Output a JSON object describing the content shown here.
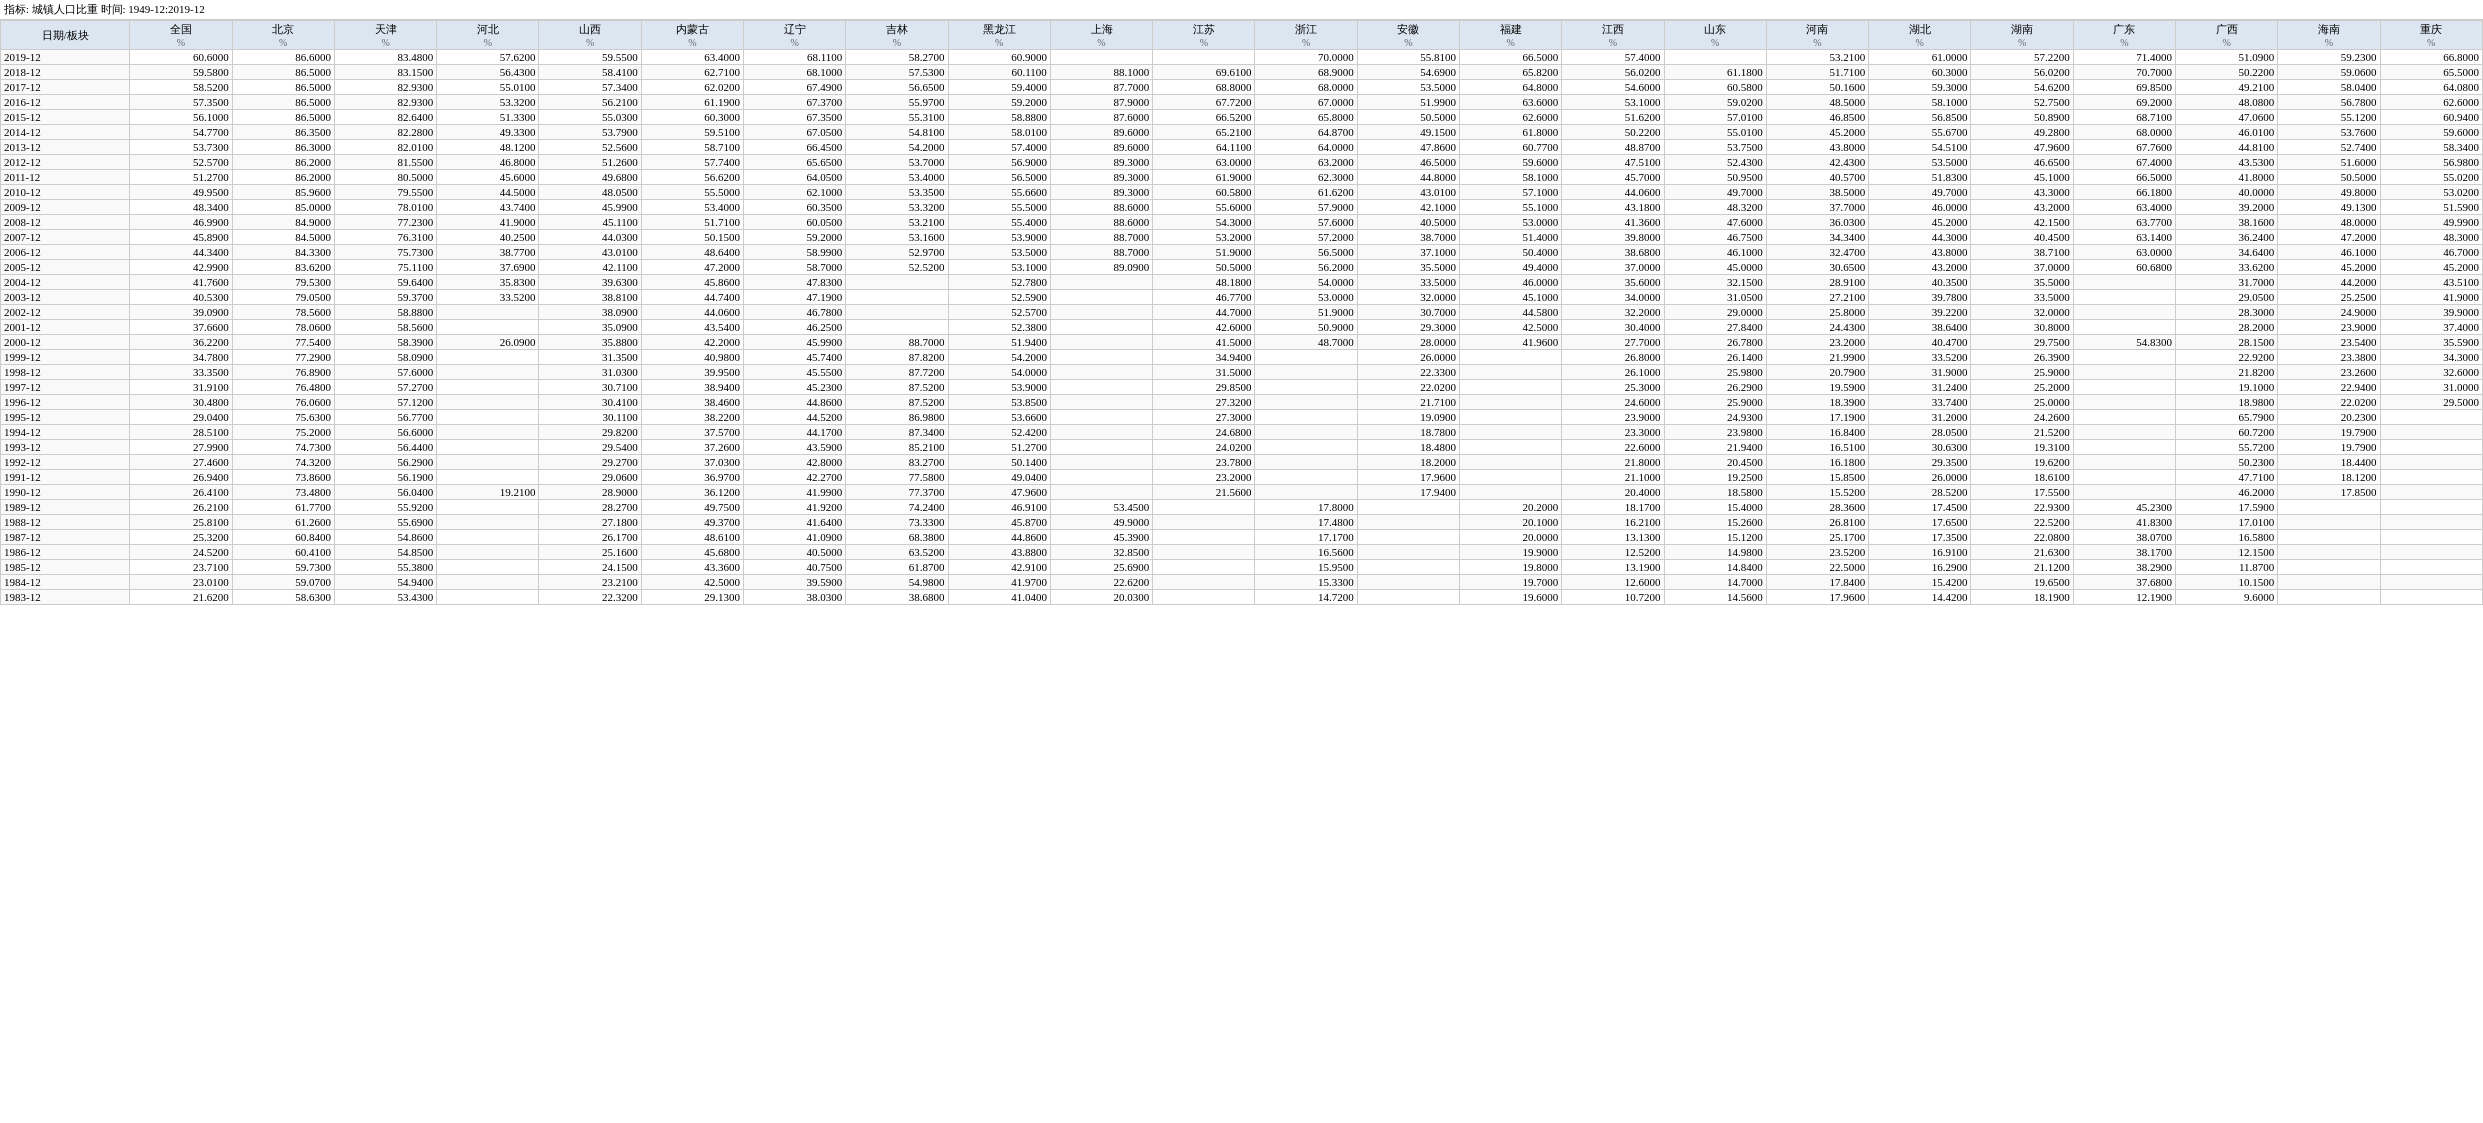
{
  "title": "指标: 城镇人口比重  时间: 1949-12:2019-12",
  "columns": [
    "日期/板块",
    "全国\n%",
    "北京\n%",
    "天津\n%",
    "河北\n%",
    "山西\n%",
    "内蒙古\n%",
    "辽宁\n%",
    "吉林\n%",
    "黑龙江\n%",
    "上海\n%",
    "江苏\n%",
    "浙江\n%",
    "安徽\n%",
    "福建\n%",
    "江西\n%",
    "山东\n%",
    "河南\n%",
    "湖北\n%",
    "湖南\n%",
    "广东\n%",
    "广西\n%",
    "海南\n%",
    "重庆\n%"
  ],
  "rows": [
    [
      "2019-12",
      "60.6000",
      "86.6000",
      "83.4800",
      "57.6200",
      "59.5500",
      "63.4000",
      "68.1100",
      "58.2700",
      "60.9000",
      "",
      "",
      "70.0000",
      "55.8100",
      "66.5000",
      "57.4000",
      "",
      "53.2100",
      "61.0000",
      "57.2200",
      "71.4000",
      "51.0900",
      "59.2300",
      "66.8000"
    ],
    [
      "2018-12",
      "59.5800",
      "86.5000",
      "83.1500",
      "56.4300",
      "58.4100",
      "62.7100",
      "68.1000",
      "57.5300",
      "60.1100",
      "88.1000",
      "69.6100",
      "68.9000",
      "54.6900",
      "65.8200",
      "56.0200",
      "61.1800",
      "51.7100",
      "60.3000",
      "56.0200",
      "70.7000",
      "50.2200",
      "59.0600",
      "65.5000"
    ],
    [
      "2017-12",
      "58.5200",
      "86.5000",
      "82.9300",
      "55.0100",
      "57.3400",
      "62.0200",
      "67.4900",
      "56.6500",
      "59.4000",
      "87.7000",
      "68.8000",
      "68.0000",
      "53.5000",
      "64.8000",
      "54.6000",
      "60.5800",
      "50.1600",
      "59.3000",
      "54.6200",
      "69.8500",
      "49.2100",
      "58.0400",
      "64.0800"
    ],
    [
      "2016-12",
      "57.3500",
      "86.5000",
      "82.9300",
      "53.3200",
      "56.2100",
      "61.1900",
      "67.3700",
      "55.9700",
      "59.2000",
      "87.9000",
      "67.7200",
      "67.0000",
      "51.9900",
      "63.6000",
      "53.1000",
      "59.0200",
      "48.5000",
      "58.1000",
      "52.7500",
      "69.2000",
      "48.0800",
      "56.7800",
      "62.6000"
    ],
    [
      "2015-12",
      "56.1000",
      "86.5000",
      "82.6400",
      "51.3300",
      "55.0300",
      "60.3000",
      "67.3500",
      "55.3100",
      "58.8800",
      "87.6000",
      "66.5200",
      "65.8000",
      "50.5000",
      "62.6000",
      "51.6200",
      "57.0100",
      "46.8500",
      "56.8500",
      "50.8900",
      "68.7100",
      "47.0600",
      "55.1200",
      "60.9400"
    ],
    [
      "2014-12",
      "54.7700",
      "86.3500",
      "82.2800",
      "49.3300",
      "53.7900",
      "59.5100",
      "67.0500",
      "54.8100",
      "58.0100",
      "89.6000",
      "65.2100",
      "64.8700",
      "49.1500",
      "61.8000",
      "50.2200",
      "55.0100",
      "45.2000",
      "55.6700",
      "49.2800",
      "68.0000",
      "46.0100",
      "53.7600",
      "59.6000"
    ],
    [
      "2013-12",
      "53.7300",
      "86.3000",
      "82.0100",
      "48.1200",
      "52.5600",
      "58.7100",
      "66.4500",
      "54.2000",
      "57.4000",
      "89.6000",
      "64.1100",
      "64.0000",
      "47.8600",
      "60.7700",
      "48.8700",
      "53.7500",
      "43.8000",
      "54.5100",
      "47.9600",
      "67.7600",
      "44.8100",
      "52.7400",
      "58.3400"
    ],
    [
      "2012-12",
      "52.5700",
      "86.2000",
      "81.5500",
      "46.8000",
      "51.2600",
      "57.7400",
      "65.6500",
      "53.7000",
      "56.9000",
      "89.3000",
      "63.0000",
      "63.2000",
      "46.5000",
      "59.6000",
      "47.5100",
      "52.4300",
      "42.4300",
      "53.5000",
      "46.6500",
      "67.4000",
      "43.5300",
      "51.6000",
      "56.9800"
    ],
    [
      "2011-12",
      "51.2700",
      "86.2000",
      "80.5000",
      "45.6000",
      "49.6800",
      "56.6200",
      "64.0500",
      "53.4000",
      "56.5000",
      "89.3000",
      "61.9000",
      "62.3000",
      "44.8000",
      "58.1000",
      "45.7000",
      "50.9500",
      "40.5700",
      "51.8300",
      "45.1000",
      "66.5000",
      "41.8000",
      "50.5000",
      "55.0200"
    ],
    [
      "2010-12",
      "49.9500",
      "85.9600",
      "79.5500",
      "44.5000",
      "48.0500",
      "55.5000",
      "62.1000",
      "53.3500",
      "55.6600",
      "89.3000",
      "60.5800",
      "61.6200",
      "43.0100",
      "57.1000",
      "44.0600",
      "49.7000",
      "38.5000",
      "49.7000",
      "43.3000",
      "66.1800",
      "40.0000",
      "49.8000",
      "53.0200"
    ],
    [
      "2009-12",
      "48.3400",
      "85.0000",
      "78.0100",
      "43.7400",
      "45.9900",
      "53.4000",
      "60.3500",
      "53.3200",
      "55.5000",
      "88.6000",
      "55.6000",
      "57.9000",
      "42.1000",
      "55.1000",
      "43.1800",
      "48.3200",
      "37.7000",
      "46.0000",
      "43.2000",
      "63.4000",
      "39.2000",
      "49.1300",
      "51.5900"
    ],
    [
      "2008-12",
      "46.9900",
      "84.9000",
      "77.2300",
      "41.9000",
      "45.1100",
      "51.7100",
      "60.0500",
      "53.2100",
      "55.4000",
      "88.6000",
      "54.3000",
      "57.6000",
      "40.5000",
      "53.0000",
      "41.3600",
      "47.6000",
      "36.0300",
      "45.2000",
      "42.1500",
      "63.7700",
      "38.1600",
      "48.0000",
      "49.9900"
    ],
    [
      "2007-12",
      "45.8900",
      "84.5000",
      "76.3100",
      "40.2500",
      "44.0300",
      "50.1500",
      "59.2000",
      "53.1600",
      "53.9000",
      "88.7000",
      "53.2000",
      "57.2000",
      "38.7000",
      "51.4000",
      "39.8000",
      "46.7500",
      "34.3400",
      "44.3000",
      "40.4500",
      "63.1400",
      "36.2400",
      "47.2000",
      "48.3000"
    ],
    [
      "2006-12",
      "44.3400",
      "84.3300",
      "75.7300",
      "38.7700",
      "43.0100",
      "48.6400",
      "58.9900",
      "52.9700",
      "53.5000",
      "88.7000",
      "51.9000",
      "56.5000",
      "37.1000",
      "50.4000",
      "38.6800",
      "46.1000",
      "32.4700",
      "43.8000",
      "38.7100",
      "63.0000",
      "34.6400",
      "46.1000",
      "46.7000"
    ],
    [
      "2005-12",
      "42.9900",
      "83.6200",
      "75.1100",
      "37.6900",
      "42.1100",
      "47.2000",
      "58.7000",
      "52.5200",
      "53.1000",
      "89.0900",
      "50.5000",
      "56.2000",
      "35.5000",
      "49.4000",
      "37.0000",
      "45.0000",
      "30.6500",
      "43.2000",
      "37.0000",
      "60.6800",
      "33.6200",
      "45.2000",
      "45.2000"
    ],
    [
      "2004-12",
      "41.7600",
      "79.5300",
      "59.6400",
      "35.8300",
      "39.6300",
      "45.8600",
      "47.8300",
      "",
      "52.7800",
      "",
      "48.1800",
      "54.0000",
      "33.5000",
      "46.0000",
      "35.6000",
      "32.1500",
      "28.9100",
      "40.3500",
      "35.5000",
      "",
      "31.7000",
      "44.2000",
      "43.5100"
    ],
    [
      "2003-12",
      "40.5300",
      "79.0500",
      "59.3700",
      "33.5200",
      "38.8100",
      "44.7400",
      "47.1900",
      "",
      "52.5900",
      "",
      "46.7700",
      "53.0000",
      "32.0000",
      "45.1000",
      "34.0000",
      "31.0500",
      "27.2100",
      "39.7800",
      "33.5000",
      "",
      "29.0500",
      "25.2500",
      "41.9000"
    ],
    [
      "2002-12",
      "39.0900",
      "78.5600",
      "58.8800",
      "",
      "38.0900",
      "44.0600",
      "46.7800",
      "",
      "52.5700",
      "",
      "44.7000",
      "51.9000",
      "30.7000",
      "44.5800",
      "32.2000",
      "29.0000",
      "25.8000",
      "39.2200",
      "32.0000",
      "",
      "28.3000",
      "24.9000",
      "39.9000"
    ],
    [
      "2001-12",
      "37.6600",
      "78.0600",
      "58.5600",
      "",
      "35.0900",
      "43.5400",
      "46.2500",
      "",
      "52.3800",
      "",
      "42.6000",
      "50.9000",
      "29.3000",
      "42.5000",
      "30.4000",
      "27.8400",
      "24.4300",
      "38.6400",
      "30.8000",
      "",
      "28.2000",
      "23.9000",
      "37.4000"
    ],
    [
      "2000-12",
      "36.2200",
      "77.5400",
      "58.3900",
      "26.0900",
      "35.8800",
      "42.2000",
      "45.9900",
      "88.7000",
      "51.9400",
      "",
      "41.5000",
      "48.7000",
      "28.0000",
      "41.9600",
      "27.7000",
      "26.7800",
      "23.2000",
      "40.4700",
      "29.7500",
      "54.8300",
      "28.1500",
      "23.5400",
      "35.5900"
    ],
    [
      "1999-12",
      "34.7800",
      "77.2900",
      "58.0900",
      "",
      "31.3500",
      "40.9800",
      "45.7400",
      "87.8200",
      "54.2000",
      "",
      "34.9400",
      "",
      "26.0000",
      "",
      "26.8000",
      "26.1400",
      "21.9900",
      "33.5200",
      "26.3900",
      "",
      "22.9200",
      "23.3800",
      "34.3000"
    ],
    [
      "1998-12",
      "33.3500",
      "76.8900",
      "57.6000",
      "",
      "31.0300",
      "39.9500",
      "45.5500",
      "87.7200",
      "54.0000",
      "",
      "31.5000",
      "",
      "22.3300",
      "",
      "26.1000",
      "25.9800",
      "20.7900",
      "31.9000",
      "25.9000",
      "",
      "21.8200",
      "23.2600",
      "32.6000"
    ],
    [
      "1997-12",
      "31.9100",
      "76.4800",
      "57.2700",
      "",
      "30.7100",
      "38.9400",
      "45.2300",
      "87.5200",
      "53.9000",
      "",
      "29.8500",
      "",
      "22.0200",
      "",
      "25.3000",
      "26.2900",
      "19.5900",
      "31.2400",
      "25.2000",
      "",
      "19.1000",
      "22.9400",
      "31.0000"
    ],
    [
      "1996-12",
      "30.4800",
      "76.0600",
      "57.1200",
      "",
      "30.4100",
      "38.4600",
      "44.8600",
      "87.5200",
      "53.8500",
      "",
      "27.3200",
      "",
      "21.7100",
      "",
      "24.6000",
      "25.9000",
      "18.3900",
      "33.7400",
      "25.0000",
      "",
      "18.9800",
      "22.0200",
      "29.5000"
    ],
    [
      "1995-12",
      "29.0400",
      "75.6300",
      "56.7700",
      "",
      "30.1100",
      "38.2200",
      "44.5200",
      "86.9800",
      "53.6600",
      "",
      "27.3000",
      "",
      "19.0900",
      "",
      "23.9000",
      "24.9300",
      "17.1900",
      "31.2000",
      "24.2600",
      "",
      "65.7900",
      "20.2300",
      ""
    ],
    [
      "1994-12",
      "28.5100",
      "75.2000",
      "56.6000",
      "",
      "29.8200",
      "37.5700",
      "44.1700",
      "87.3400",
      "52.4200",
      "",
      "24.6800",
      "",
      "18.7800",
      "",
      "23.3000",
      "23.9800",
      "16.8400",
      "28.0500",
      "21.5200",
      "",
      "60.7200",
      "19.7900",
      ""
    ],
    [
      "1993-12",
      "27.9900",
      "74.7300",
      "56.4400",
      "",
      "29.5400",
      "37.2600",
      "43.5900",
      "85.2100",
      "51.2700",
      "",
      "24.0200",
      "",
      "18.4800",
      "",
      "22.6000",
      "21.9400",
      "16.5100",
      "30.6300",
      "19.3100",
      "",
      "55.7200",
      "19.7900",
      ""
    ],
    [
      "1992-12",
      "27.4600",
      "74.3200",
      "56.2900",
      "",
      "29.2700",
      "37.0300",
      "42.8000",
      "83.2700",
      "50.1400",
      "",
      "23.7800",
      "",
      "18.2000",
      "",
      "21.8000",
      "20.4500",
      "16.1800",
      "29.3500",
      "19.6200",
      "",
      "50.2300",
      "18.4400",
      ""
    ],
    [
      "1991-12",
      "26.9400",
      "73.8600",
      "56.1900",
      "",
      "29.0600",
      "36.9700",
      "42.2700",
      "77.5800",
      "49.0400",
      "",
      "23.2000",
      "",
      "17.9600",
      "",
      "21.1000",
      "19.2500",
      "15.8500",
      "26.0000",
      "18.6100",
      "",
      "47.7100",
      "18.1200",
      ""
    ],
    [
      "1990-12",
      "26.4100",
      "73.4800",
      "56.0400",
      "19.2100",
      "28.9000",
      "36.1200",
      "41.9900",
      "77.3700",
      "47.9600",
      "",
      "21.5600",
      "",
      "17.9400",
      "",
      "20.4000",
      "18.5800",
      "15.5200",
      "28.5200",
      "17.5500",
      "",
      "46.2000",
      "17.8500",
      ""
    ],
    [
      "1989-12",
      "26.2100",
      "61.7700",
      "55.9200",
      "",
      "28.2700",
      "49.7500",
      "41.9200",
      "74.2400",
      "46.9100",
      "53.4500",
      "",
      "17.8000",
      "",
      "20.2000",
      "18.1700",
      "15.4000",
      "28.3600",
      "17.4500",
      "22.9300",
      "45.2300",
      "17.5900",
      "",
      ""
    ],
    [
      "1988-12",
      "25.8100",
      "61.2600",
      "55.6900",
      "",
      "27.1800",
      "49.3700",
      "41.6400",
      "73.3300",
      "45.8700",
      "49.9000",
      "",
      "17.4800",
      "",
      "20.1000",
      "16.2100",
      "15.2600",
      "26.8100",
      "17.6500",
      "22.5200",
      "41.8300",
      "17.0100",
      "",
      ""
    ],
    [
      "1987-12",
      "25.3200",
      "60.8400",
      "54.8600",
      "",
      "26.1700",
      "48.6100",
      "41.0900",
      "68.3800",
      "44.8600",
      "45.3900",
      "",
      "17.1700",
      "",
      "20.0000",
      "13.1300",
      "15.1200",
      "25.1700",
      "17.3500",
      "22.0800",
      "38.0700",
      "16.5800",
      "",
      ""
    ],
    [
      "1986-12",
      "24.5200",
      "60.4100",
      "54.8500",
      "",
      "25.1600",
      "45.6800",
      "40.5000",
      "63.5200",
      "43.8800",
      "32.8500",
      "",
      "16.5600",
      "",
      "19.9000",
      "12.5200",
      "14.9800",
      "23.5200",
      "16.9100",
      "21.6300",
      "38.1700",
      "12.1500",
      "",
      ""
    ],
    [
      "1985-12",
      "23.7100",
      "59.7300",
      "55.3800",
      "",
      "24.1500",
      "43.3600",
      "40.7500",
      "61.8700",
      "42.9100",
      "25.6900",
      "",
      "15.9500",
      "",
      "19.8000",
      "13.1900",
      "14.8400",
      "22.5000",
      "16.2900",
      "21.1200",
      "38.2900",
      "11.8700",
      "",
      ""
    ],
    [
      "1984-12",
      "23.0100",
      "59.0700",
      "54.9400",
      "",
      "23.2100",
      "42.5000",
      "39.5900",
      "54.9800",
      "41.9700",
      "22.6200",
      "",
      "15.3300",
      "",
      "19.7000",
      "12.6000",
      "14.7000",
      "17.8400",
      "15.4200",
      "19.6500",
      "37.6800",
      "10.1500",
      "",
      ""
    ],
    [
      "1983-12",
      "21.6200",
      "58.6300",
      "53.4300",
      "",
      "22.3200",
      "29.1300",
      "38.0300",
      "38.6800",
      "41.0400",
      "20.0300",
      "",
      "14.7200",
      "",
      "19.6000",
      "10.7200",
      "14.5600",
      "17.9600",
      "14.4200",
      "18.1900",
      "12.1900",
      "9.6000",
      "",
      ""
    ]
  ]
}
